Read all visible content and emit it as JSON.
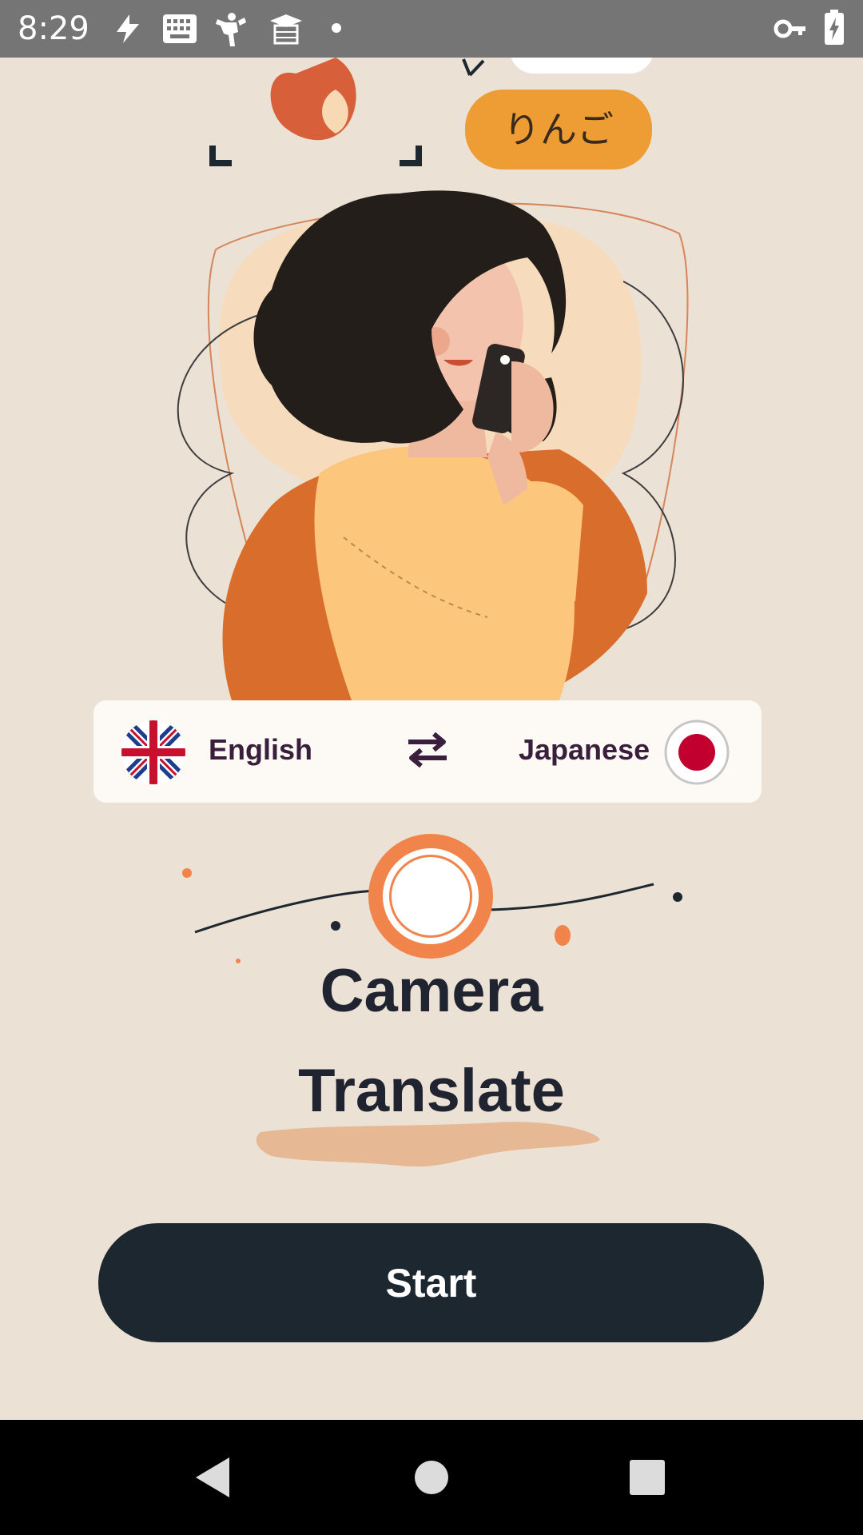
{
  "status_bar": {
    "time": "8:29",
    "icons": [
      "flash-icon",
      "keyboard-icon",
      "fitness-icon",
      "school-icon",
      "dot-icon",
      "vpn-key-icon",
      "battery-charging-icon"
    ]
  },
  "hero": {
    "speech_bubble_text": "りんご"
  },
  "language_selector": {
    "source_language": "English",
    "target_language": "Japanese",
    "source_flag": "uk-flag-icon",
    "target_flag": "japan-flag-icon",
    "swap_icon": "swap-arrows-icon"
  },
  "title": {
    "line1": "Camera",
    "line2": "Translate"
  },
  "start_button": {
    "label": "Start"
  },
  "colors": {
    "background": "#ebe1d5",
    "accent_orange": "#f0844a",
    "dark": "#1c2730",
    "bubble": "#ee9d34"
  },
  "nav_bar": {
    "buttons": [
      "back-icon",
      "home-icon",
      "recents-icon"
    ]
  }
}
